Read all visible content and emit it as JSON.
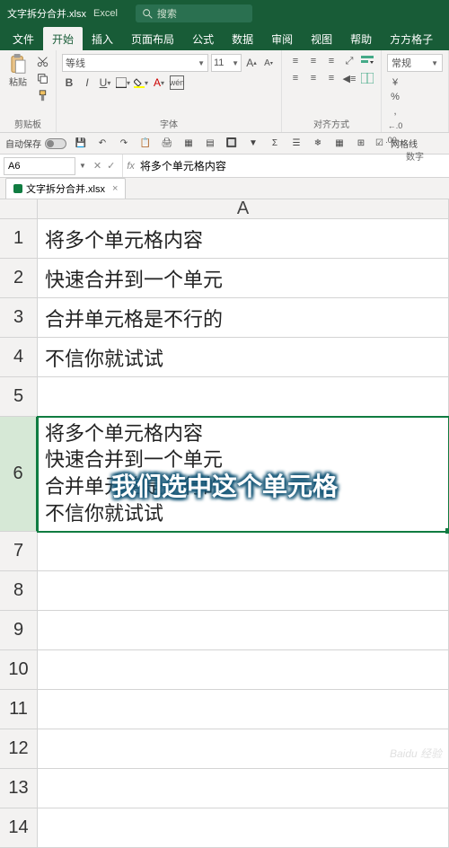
{
  "title": {
    "filename": "文字拆分合并.xlsx",
    "app": "Excel",
    "search_placeholder": "搜索"
  },
  "tabs": {
    "t0": "文件",
    "t1": "开始",
    "t2": "插入",
    "t3": "页面布局",
    "t4": "公式",
    "t5": "数据",
    "t6": "审阅",
    "t7": "视图",
    "t8": "帮助",
    "t9": "方方格子"
  },
  "ribbon": {
    "clipboard": {
      "paste": "粘贴",
      "label": "剪贴板"
    },
    "font": {
      "name": "等线",
      "size": "11",
      "label": "字体"
    },
    "align": {
      "label": "对齐方式"
    },
    "number": {
      "format": "常规",
      "label": "数字"
    }
  },
  "qat": {
    "autosave": "自动保存",
    "gridlines": "网格线"
  },
  "fbar": {
    "name": "A6",
    "value": "将多个单元格内容"
  },
  "sheettab": {
    "name": "文字拆分合并.xlsx"
  },
  "cells": {
    "a1": "将多个单元格内容",
    "a2": "快速合并到一个单元",
    "a3": "合并单元格是不行的",
    "a4": "不信你就试试",
    "a6l1": "将多个单元格内容",
    "a6l2": "快速合并到一个单元",
    "a6l3": "合并单元格是不行的",
    "a6l4": "不信你就试试"
  },
  "colheads": {
    "a": "A"
  },
  "rowheads": {
    "r1": "1",
    "r2": "2",
    "r3": "3",
    "r4": "4",
    "r5": "5",
    "r6": "6",
    "r7": "7",
    "r8": "8",
    "r9": "9",
    "r10": "10",
    "r11": "11",
    "r12": "12",
    "r13": "13",
    "r14": "14"
  },
  "caption": "我们选中这个单元格",
  "watermark": "Baidu 经验"
}
